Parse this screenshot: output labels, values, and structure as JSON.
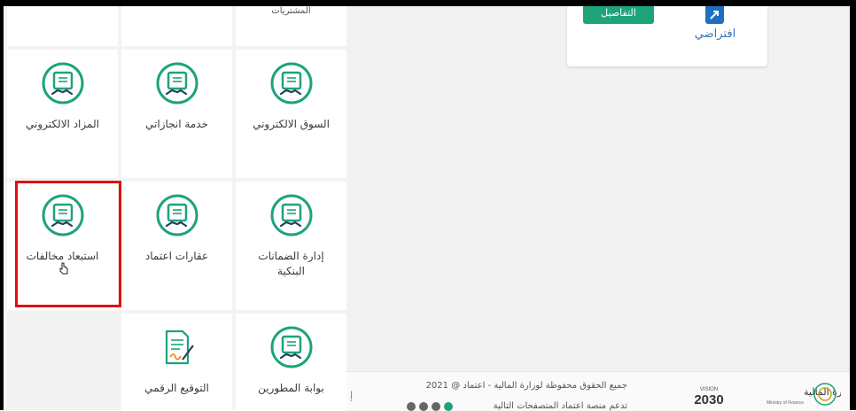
{
  "tiles": [
    {
      "label": "المزاد الالكتروني"
    },
    {
      "label": "خدمة انجازاتي"
    },
    {
      "label": "السوق الالكتروني"
    },
    {
      "label": "استبعاد مخالفات"
    },
    {
      "label": "عقارات اعتماد"
    },
    {
      "label": "إدارة الضمانات",
      "label2": "البنكية"
    },
    {
      "label": "التوقيع الرقمي"
    },
    {
      "label": "بوابة المطورين"
    }
  ],
  "top_tile_label": "المشتريات",
  "header_card": {
    "green_button_label": "التفاصيل",
    "virtual_label": "افتراضي"
  },
  "footer": {
    "copyright": "جميع الحقوق محفوظة لوزارة المالية - اعتماد @ 2021",
    "supported": "تدعم منصة اعتماد المتصفحات التالية",
    "edge_char": "إ",
    "vision_text": "VISION 2030",
    "ministry_name": "وزارة المالية",
    "ministry_en": "Ministry of Finance"
  },
  "colors": {
    "accent_green": "#1ea37a",
    "highlight_red": "#e01010",
    "link_blue": "#3a73b8"
  }
}
